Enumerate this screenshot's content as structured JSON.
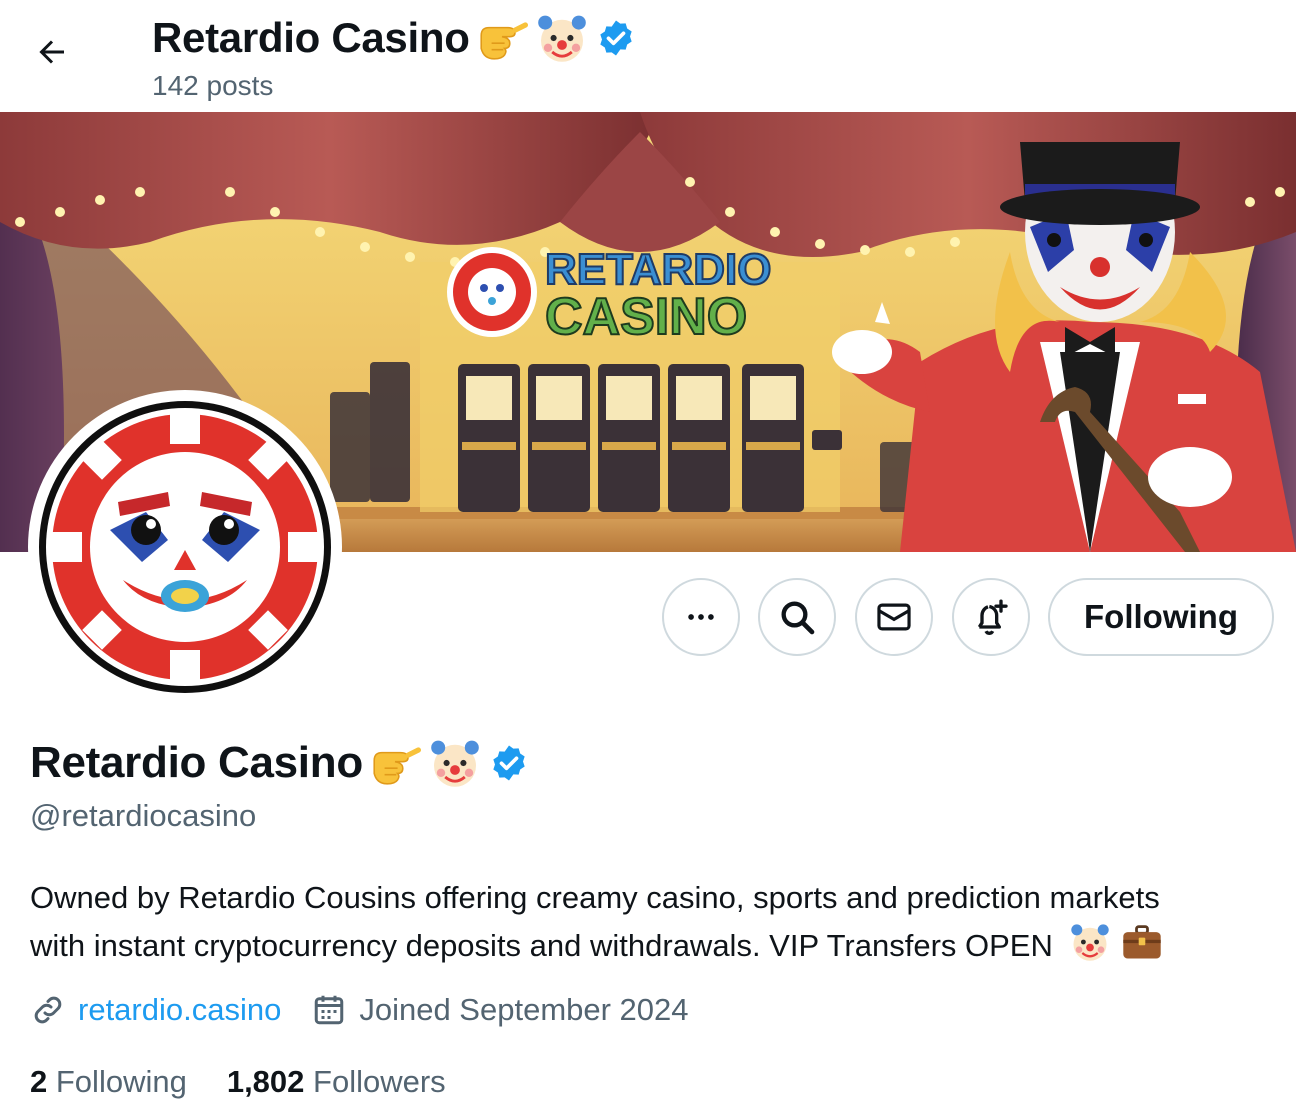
{
  "header": {
    "name": "Retardio Casino",
    "posts_label": "142 posts"
  },
  "profile": {
    "name": "Retardio Casino",
    "handle": "@retardiocasino",
    "bio_line1": "Owned by Retardio Cousins offering creamy casino, sports and prediction markets",
    "bio_line2": "with instant cryptocurrency deposits and withdrawals. VIP Transfers OPEN",
    "website": "retardio.casino",
    "joined": "Joined September 2024",
    "following_count": "2",
    "following_label": "Following",
    "followers_count": "1,802",
    "followers_label": "Followers"
  },
  "banner": {
    "sign_line1": "RETARDIO",
    "sign_line2": "CASINO"
  },
  "actions": {
    "follow_state_label": "Following"
  },
  "icons": {
    "back": "arrow-left-icon",
    "more": "more-icon",
    "search": "search-icon",
    "message": "envelope-icon",
    "notify": "bell-plus-icon",
    "link": "link-icon",
    "calendar": "calendar-icon",
    "verified": "verified-badge-icon",
    "pointing": "pointing-hand-emoji",
    "clown": "clown-face-emoji",
    "briefcase": "briefcase-emoji"
  },
  "colors": {
    "accent": "#1d9bf0",
    "text": "#0f1419",
    "muted": "#536471",
    "border": "#cfd9de",
    "chip_red": "#e0322b"
  }
}
